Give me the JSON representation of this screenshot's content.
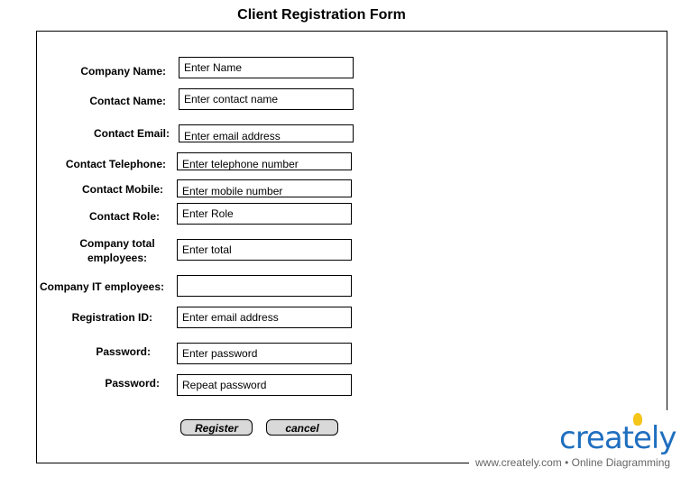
{
  "title": "Client Registration Form",
  "fields": [
    {
      "label": "Company Name:",
      "value": "Enter Name"
    },
    {
      "label": "Contact Name:",
      "value": "Enter contact name"
    },
    {
      "label": "Contact Email:",
      "value": "Enter email address"
    },
    {
      "label": "Contact Telephone:",
      "value": "Enter telephone number"
    },
    {
      "label": "Contact Mobile:",
      "value": "Enter mobile number"
    },
    {
      "label": "Contact Role:",
      "value": "Enter Role"
    },
    {
      "label": "Company total employees:",
      "value": "Enter total"
    },
    {
      "label": "Company IT employees:",
      "value": ""
    },
    {
      "label": "Registration ID:",
      "value": "Enter email address"
    },
    {
      "label": "Password:",
      "value": "Enter password"
    },
    {
      "label": "Password:",
      "value": "Repeat password"
    }
  ],
  "buttons": {
    "register": "Register",
    "cancel": "cancel"
  },
  "brand": {
    "name": "creately",
    "tagline": "www.creately.com • Online Diagramming",
    "color": "#1f6fbf"
  }
}
